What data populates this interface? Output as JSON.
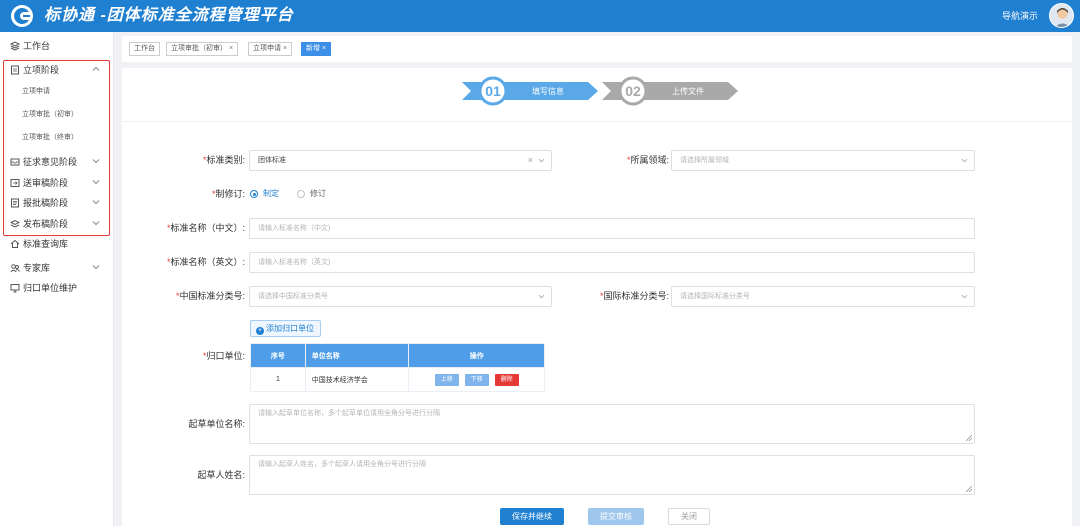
{
  "header": {
    "title": "标协通 -团体标准全流程管理平台",
    "nav_demo": "导航演示"
  },
  "colors": {
    "brand": "#1f7fd1",
    "danger": "#e53935",
    "table_header": "#4f9de8"
  },
  "sidebar": {
    "items": [
      {
        "label": "工作台",
        "icon": "desktop-icon"
      },
      {
        "label": "立项阶段",
        "icon": "file-icon",
        "expanded": true,
        "children": [
          "立项申请",
          "立项审批（初审）",
          "立项审批（终审）"
        ]
      },
      {
        "label": "征求意见阶段",
        "icon": "inbox-icon"
      },
      {
        "label": "送审稿阶段",
        "icon": "send-icon"
      },
      {
        "label": "报批稿阶段",
        "icon": "document-icon"
      },
      {
        "label": "发布稿阶段",
        "icon": "layers-icon"
      },
      {
        "label": "标准查询库",
        "icon": "home-icon"
      },
      {
        "label": "专家库",
        "icon": "users-icon"
      },
      {
        "label": "归口单位维护",
        "icon": "monitor-icon"
      }
    ]
  },
  "tags": [
    {
      "label": "工作台",
      "closable": false
    },
    {
      "label": "立项审批（初审）",
      "closable": true
    },
    {
      "label": "立项申请",
      "closable": true
    },
    {
      "label": "新增",
      "closable": true,
      "active": true
    }
  ],
  "steps": [
    {
      "num": "01",
      "label": "填写信息",
      "active": true
    },
    {
      "num": "02",
      "label": "上传文件",
      "active": false
    }
  ],
  "form": {
    "std_type": {
      "label": "标准类别:",
      "value": "团体标准"
    },
    "domain": {
      "label": "所属领域:",
      "placeholder": "请选择所属领域"
    },
    "revision": {
      "label": "制修订:",
      "options": [
        "制定",
        "修订"
      ],
      "selected": "制定"
    },
    "name_cn": {
      "label": "标准名称（中文）:",
      "placeholder": "请输入标准名称（中文)"
    },
    "name_en": {
      "label": "标准名称（英文）:",
      "placeholder": "请输入标准名称（英文)"
    },
    "ccs": {
      "label": "中国标准分类号:",
      "placeholder": "请选择中国标准分类号"
    },
    "ics": {
      "label": "国际标准分类号:",
      "placeholder": "请选择国际标准分类号"
    },
    "unit": {
      "label": "归口单位:",
      "add_label": "添加归口单位",
      "columns": [
        "序号",
        "单位名称",
        "操作"
      ],
      "rows": [
        {
          "no": "1",
          "name": "中国技术经济学会"
        }
      ],
      "actions": [
        "上移",
        "下移",
        "删除"
      ]
    },
    "draft_unit": {
      "label": "起草单位名称:",
      "placeholder": "请输入起草单位名称，多个起草单位请用全角分号进行分隔"
    },
    "drafter": {
      "label": "起草人姓名:",
      "placeholder": "请输入起草人姓名，多个起草人请用全角分号进行分隔"
    }
  },
  "buttons": {
    "save": "保存并继续",
    "submit": "提交审核",
    "close": "关闭"
  }
}
